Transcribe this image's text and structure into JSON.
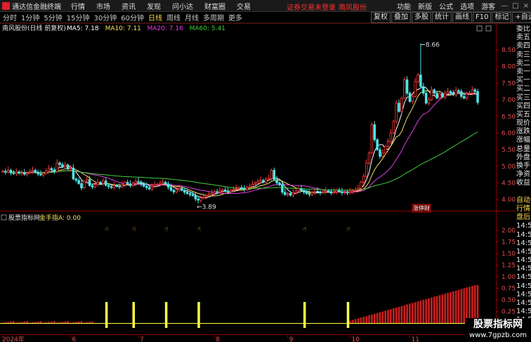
{
  "app": {
    "name": "通达信金融终端"
  },
  "menu": [
    "行情",
    "市场",
    "资讯",
    "发现",
    "问小达",
    "财富圈",
    "交易"
  ],
  "notice": {
    "text": "证券交易未登录",
    "stock": "南风股份"
  },
  "right_menu": [
    "功能",
    "新版",
    "公式",
    "选项",
    "游客"
  ],
  "window_controls": [
    "—",
    "□",
    "×"
  ],
  "periods": [
    "分时",
    "1分钟",
    "5分钟",
    "15分钟",
    "30分钟",
    "60分钟",
    "日线",
    "周线",
    "月线",
    "多周期",
    "更多"
  ],
  "active_period": "日线",
  "tools": [
    "复权",
    "叠加",
    "多股",
    "统计",
    "画线",
    "F10",
    "标记",
    "+自选"
  ],
  "main_panel": {
    "title": "南风股份(日线 前复权)",
    "ma": [
      {
        "label": "MA5: 7.18",
        "color": "#ffffff"
      },
      {
        "label": "MA10: 7.11",
        "color": "#f0e060"
      },
      {
        "label": "MA20: 7.16",
        "color": "#e040e0"
      },
      {
        "label": "MA60: 5.41",
        "color": "#40d040"
      }
    ],
    "high_label": "8.66",
    "low_label": "3.89",
    "badge": "涨停财"
  },
  "sub_panel": {
    "title": "股票指标网",
    "indicator": "金手指A: 0.00",
    "marker_count": 6
  },
  "chart_data": {
    "type": "candlestick",
    "price_axis": [
      "8.50",
      "8.00",
      "7.50",
      "7.00",
      "6.50",
      "6.00",
      "5.50",
      "5.00",
      "4.50",
      "4.00"
    ],
    "ylim": [
      3.75,
      9.05
    ],
    "sub_axis": [
      "2.00",
      "1.75",
      "1.50",
      "1.25",
      "1.00",
      "0.75",
      "0.50",
      "0.25"
    ],
    "sub_ylim": [
      0,
      2.15
    ],
    "date_labels": [
      {
        "label": "2024年",
        "idx": 0
      },
      {
        "label": "6",
        "idx": 25
      },
      {
        "label": "7",
        "idx": 50
      },
      {
        "label": "8",
        "idx": 78
      },
      {
        "label": "9",
        "idx": 105
      },
      {
        "label": "10",
        "idx": 128
      },
      {
        "label": "11",
        "idx": 150
      }
    ],
    "close": [
      4.85,
      4.82,
      4.88,
      4.8,
      4.78,
      4.83,
      4.79,
      4.81,
      4.76,
      4.8,
      4.84,
      4.88,
      4.82,
      4.77,
      4.74,
      4.79,
      4.86,
      4.93,
      4.89,
      4.84,
      5.1,
      5.05,
      4.98,
      5.04,
      4.92,
      4.95,
      4.62,
      4.58,
      4.48,
      4.35,
      4.55,
      4.6,
      4.42,
      4.38,
      4.45,
      4.52,
      4.48,
      4.56,
      4.43,
      4.39,
      4.36,
      4.42,
      4.4,
      4.38,
      4.44,
      4.52,
      4.47,
      4.43,
      4.49,
      4.55,
      4.53,
      4.46,
      4.4,
      4.36,
      4.32,
      4.4,
      4.44,
      4.46,
      4.49,
      4.52,
      4.47,
      4.37,
      4.28,
      4.23,
      4.3,
      4.34,
      4.28,
      4.22,
      4.18,
      4.15,
      4.12,
      4.02,
      3.98,
      4.05,
      4.08,
      4.12,
      4.16,
      4.19,
      4.24,
      4.22,
      4.26,
      4.29,
      4.25,
      4.23,
      4.28,
      4.31,
      4.33,
      4.36,
      4.32,
      4.3,
      4.36,
      4.4,
      4.46,
      4.5,
      4.55,
      4.58,
      4.52,
      4.6,
      4.63,
      4.88,
      4.6,
      4.5,
      4.44,
      4.22,
      4.15,
      4.18,
      4.13,
      4.2,
      4.26,
      4.33,
      4.28,
      4.22,
      4.18,
      4.15,
      4.21,
      4.25,
      4.22,
      4.2,
      4.23,
      4.26,
      4.24,
      4.2,
      4.23,
      4.28,
      4.24,
      4.2,
      4.22,
      4.2,
      4.24,
      4.27,
      4.3,
      4.34,
      4.52,
      4.7,
      5.1,
      5.4,
      6.25,
      5.8,
      5.5,
      5.3,
      5.4,
      5.6,
      5.75,
      6.0,
      6.35,
      6.9,
      6.65,
      7.05,
      7.6,
      7.2,
      6.95,
      7.1,
      7.55,
      7.75,
      7.4,
      7.2,
      6.9,
      7.0,
      7.3,
      7.2,
      7.05,
      7.18,
      7.08,
      7.2,
      7.25,
      7.22,
      7.15,
      7.28,
      7.25,
      7.1,
      7.05,
      7.18,
      7.2,
      7.3,
      7.25,
      6.92
    ],
    "highlight_high_idx": 154,
    "highlight_low_idx": 72,
    "signal_idx": [
      37,
      47,
      59,
      71,
      110,
      126
    ],
    "volume_start_idx": 128
  },
  "side_labels": [
    "委比",
    "卖五",
    "卖四",
    "卖三",
    "卖二",
    "卖一",
    "买一",
    "买二",
    "买三",
    "买四",
    "买五",
    "现价",
    "涨跌",
    "涨幅",
    "总量",
    "外盘",
    "换手",
    "净资",
    "收益",
    "",
    "自动",
    "行情",
    "盘后",
    "14:5",
    "14:5",
    "14:5",
    "14:5",
    "14:5",
    "14:5",
    "14:5",
    "14:5",
    "14:5",
    "14:5",
    "14:5",
    "14:5"
  ],
  "watermark": {
    "title": "股票指标网",
    "url": "www.7gpzb.com"
  }
}
